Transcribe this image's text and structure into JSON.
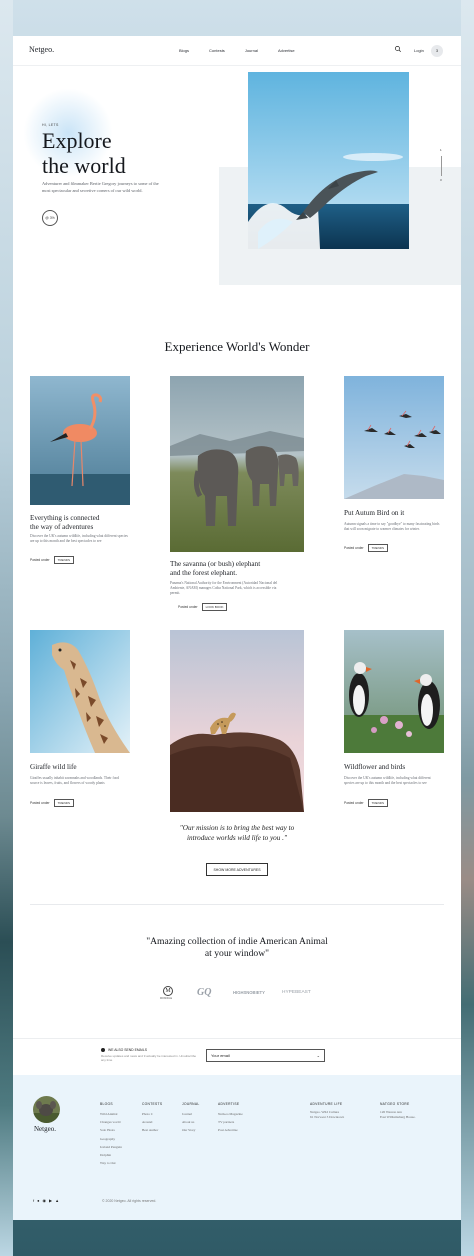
{
  "nav": {
    "logo": "Netgeo.",
    "links": [
      "Blogs",
      "Contests",
      "Journal",
      "Advertise"
    ],
    "login": "Login",
    "avatar_text": "3"
  },
  "hero": {
    "kicker": "HI, LETS",
    "title_line1": "Explore",
    "title_line2": "the world",
    "description": "Adventurer and filmmaker Bertie Gregory journeys to some of the most spectacular and secretive corners of our wild world.",
    "badge": "@ 3%",
    "pager": [
      "1",
      "3"
    ]
  },
  "section": {
    "title": "Experience World's Wonder"
  },
  "cards": [
    {
      "title_line1": "Everything is connected",
      "title_line2": "the way of adventures",
      "description": "Discover the UK's autumn wildlife, including what different species are up to this month and the best spectacles to see",
      "posted_label": "Posted under",
      "tag": "TRENDS"
    },
    {
      "title_line1": "The savanna (or bush) elephant",
      "title_line2": "and the forest elephant.",
      "description": "Panama's National Authority for the Environment (Autoridad Nacional del Ambiente, ANAM) manages Coiba National Park, which is accessible via permit.",
      "posted_label": "Posted under",
      "tag": "LOOK BOOK"
    },
    {
      "title_line1": "Put Autum Bird on it",
      "title_line2": "",
      "description": "Autumn signals a time to say \"goodbye\" to many fascinating birds that will soon migrate to warmer climates for winter.",
      "posted_label": "Posted under",
      "tag": "TRENDS"
    },
    {
      "title_line1": "Giraffe wild life",
      "title_line2": "",
      "description": "Giraffes usually inhabit savannahs and woodlands. Their food source is leaves, fruits, and flowers of woody plants",
      "posted_label": "Posted under",
      "tag": "TRENDS"
    },
    {
      "title_line1": "Wildflower and birds",
      "title_line2": "",
      "description": "Discover the UK's autumn wildlife, including what different species are up to this month and the best spectacles to see",
      "posted_label": "Posted under",
      "tag": "TRENDS"
    }
  ],
  "mission": {
    "line1": "\"Our mission is to bring the best way to",
    "line2": "introduce worlds wild life to you .\"",
    "button": "SHOW MORE ADVENTURES"
  },
  "testimonial": {
    "line1": "\"Amazing collection of indie American Animal",
    "line2": "at your window\"",
    "brands": [
      "MONOCLE",
      "GQ",
      "HIGHSNOBIETY",
      "HYPEBEAST"
    ]
  },
  "newsletter": {
    "label": "WE ALSO SEND EMAILS",
    "description": "Receive updates and news and 9 actually be interested in. Unsubscribe any time",
    "input_value": "Your email"
  },
  "footer": {
    "logo": "Netgeo.",
    "columns": [
      {
        "heading": "BLOGS",
        "items": [
          "Wild Animal",
          "Changes world",
          "Solo Hosts",
          "Geography",
          "Iceland Penguin",
          "Dolphin",
          "Way to Out"
        ]
      },
      {
        "heading": "CONTESTS",
        "items": [
          "Photo C",
          "Around",
          "Best Author"
        ]
      },
      {
        "heading": "JOURNAL",
        "items": [
          "Journal",
          "About us",
          "Our Story"
        ]
      },
      {
        "heading": "ADVERTISE",
        "items": [
          "NetGeo Magazine",
          "TV partners",
          "Post Advertise"
        ]
      },
      {
        "heading": "ADVENTURE LIFE",
        "items": [
          "Netgeo. Wild Culture",
          "61 Norwest 3 Downtown"
        ]
      },
      {
        "heading": "NATGEO STORE",
        "items": [
          "126 Weston Ave",
          "East Williamsburg House."
        ]
      }
    ],
    "socials": [
      "f",
      "t",
      "ig",
      "yt",
      "sc"
    ],
    "copyright": "© 2020 Netgeo. All rights reserved."
  }
}
